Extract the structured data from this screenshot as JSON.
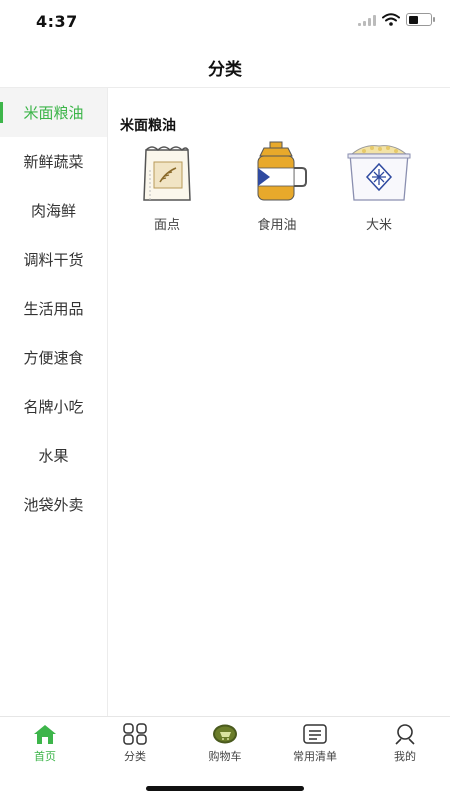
{
  "status_bar": {
    "time": "4:37"
  },
  "header": {
    "title": "分类"
  },
  "sidebar": {
    "items": [
      {
        "label": "米面粮油",
        "active": true
      },
      {
        "label": "新鲜蔬菜"
      },
      {
        "label": "肉海鲜"
      },
      {
        "label": "调料干货"
      },
      {
        "label": "生活用品"
      },
      {
        "label": "方便速食"
      },
      {
        "label": "名牌小吃"
      },
      {
        "label": "水果"
      },
      {
        "label": "池袋外卖"
      }
    ]
  },
  "content": {
    "section_title": "米面粮油",
    "products": [
      {
        "label": "面点",
        "icon": "flour-bag-icon"
      },
      {
        "label": "食用油",
        "icon": "oil-bottle-icon"
      },
      {
        "label": "大米",
        "icon": "rice-sack-icon"
      }
    ]
  },
  "tab_bar": {
    "items": [
      {
        "label": "首页",
        "icon": "home-icon",
        "active": true
      },
      {
        "label": "分类",
        "icon": "grid-icon"
      },
      {
        "label": "购物车",
        "icon": "cart-icon"
      },
      {
        "label": "常用清单",
        "icon": "list-icon"
      },
      {
        "label": "我的",
        "icon": "profile-icon"
      }
    ]
  },
  "colors": {
    "accent": "#3db54a",
    "oil_yellow": "#e8a92b",
    "oil_blue": "#2f4aa0"
  }
}
